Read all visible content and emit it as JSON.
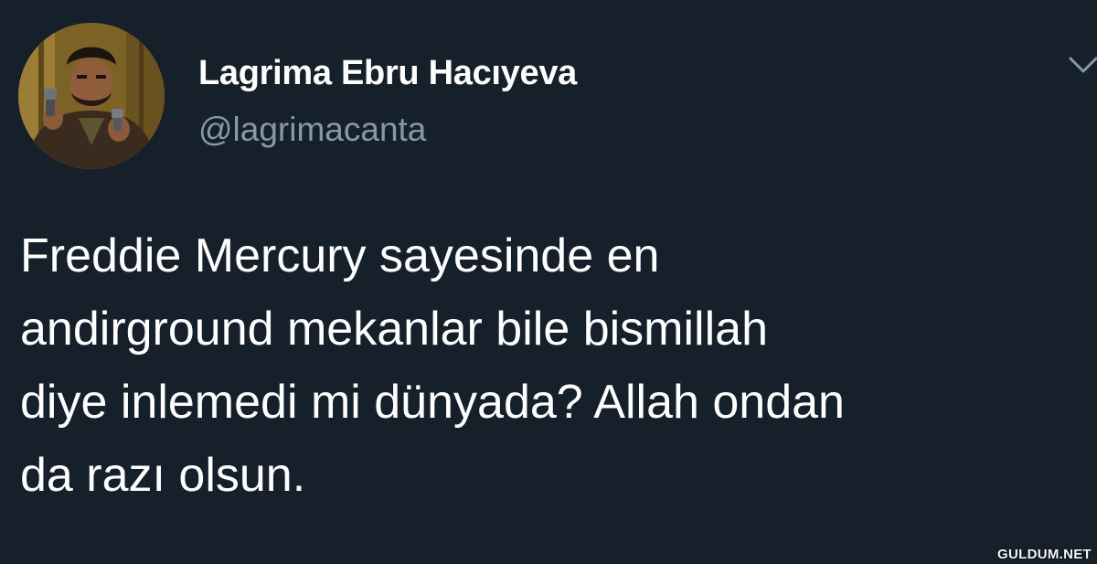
{
  "tweet": {
    "author": {
      "display_name": "Lagrima Ebru Hacıyeva",
      "username": "@lagrimacanta",
      "avatar_icon": "profile-photo"
    },
    "menu_icon": "chevron-down-icon",
    "text_lines": [
      "Freddie Mercury sayesinde en",
      "andirground mekanlar bile bismillah",
      "diye inlemedi mi dünyada? Allah ondan",
      "da razı olsun."
    ]
  },
  "watermark": "GULDUM.NET",
  "colors": {
    "background": "#15202b",
    "text_primary": "#ffffff",
    "text_secondary": "#8899a6"
  }
}
